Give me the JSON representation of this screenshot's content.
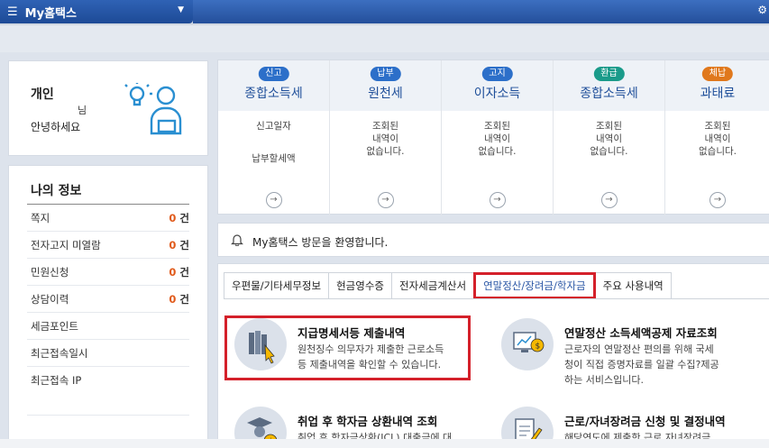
{
  "topbar": {
    "menu_label": "My홈택스"
  },
  "profile": {
    "type": "개인",
    "name_suffix": "님",
    "greeting": "안녕하세요"
  },
  "myinfo": {
    "title": "나의 정보",
    "items": [
      {
        "label": "쪽지",
        "count": "0",
        "unit": "건"
      },
      {
        "label": "전자고지 미열람",
        "count": "0",
        "unit": "건"
      },
      {
        "label": "민원신청",
        "count": "0",
        "unit": "건"
      },
      {
        "label": "상담이력",
        "count": "0",
        "unit": "건"
      },
      {
        "label": "세금포인트",
        "count": "",
        "unit": ""
      },
      {
        "label": "최근접속일시",
        "count": "",
        "unit": ""
      },
      {
        "label": "최근접속 IP",
        "count": "",
        "unit": ""
      }
    ]
  },
  "tax": [
    {
      "badge": "신고",
      "badge_color": "#2c6fc9",
      "title": "종합소득세",
      "lines": [
        "신고일자",
        "",
        "",
        "납부할세액"
      ]
    },
    {
      "badge": "납부",
      "badge_color": "#2c6fc9",
      "title": "원천세",
      "lines": [
        "조회된",
        "내역이",
        "없습니다."
      ]
    },
    {
      "badge": "고지",
      "badge_color": "#2c6fc9",
      "title": "이자소득",
      "lines": [
        "조회된",
        "내역이",
        "없습니다."
      ]
    },
    {
      "badge": "환급",
      "badge_color": "#1a9b8a",
      "title": "종합소득세",
      "lines": [
        "조회된",
        "내역이",
        "없습니다."
      ]
    },
    {
      "badge": "체납",
      "badge_color": "#e0781c",
      "title": "과태료",
      "lines": [
        "조회된",
        "내역이",
        "없습니다."
      ]
    }
  ],
  "welcome": {
    "message": "My홈택스 방문을 환영합니다."
  },
  "tabs": [
    {
      "label": "우편물/기타세무정보",
      "active": false
    },
    {
      "label": "현금영수증",
      "active": false
    },
    {
      "label": "전자세금계산서",
      "active": false
    },
    {
      "label": "연말정산/장려금/학자금",
      "active": true
    },
    {
      "label": "주요 사용내역",
      "active": false
    }
  ],
  "services": [
    {
      "title": "지급명세서등 제출내역",
      "desc": [
        "원천징수 의무자가 제출한 근로소득",
        "등 제출내역을 확인할 수 있습니다."
      ]
    },
    {
      "title": "연말정산 소득세액공제 자료조회",
      "desc": [
        "근로자의 연말정산 편의를 위해 국세",
        "청이 직접 증명자료를 일괄 수집?제공",
        "하는 서비스입니다."
      ]
    },
    {
      "title": "취업 후 학자금 상환내역 조회",
      "desc": [
        "취업 후 학자금상환(ICL) 대출금에 대"
      ]
    },
    {
      "title": "근로/자녀장려금 신청 및 결정내역",
      "desc": [
        "해당연도에 제출한 근로 자녀장려금"
      ]
    }
  ]
}
